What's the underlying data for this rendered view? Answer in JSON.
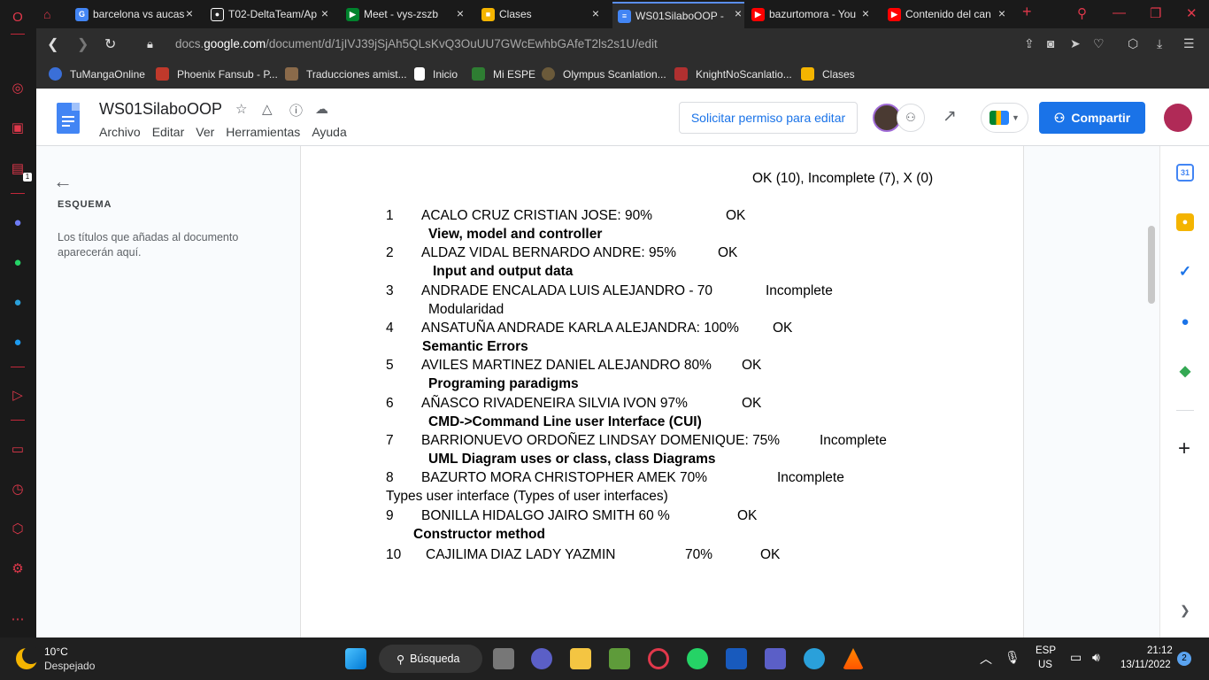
{
  "browser": {
    "tabs": [
      {
        "title": "barcelona vs aucas",
        "color": "#4285f4",
        "glyph": "G"
      },
      {
        "title": "T02-DeltaTeam/Ap",
        "color": "#222222",
        "glyph": "●"
      },
      {
        "title": "Meet - vys-zszb",
        "color": "#00832d",
        "glyph": "▶"
      },
      {
        "title": "Clases",
        "color": "#f4b400",
        "glyph": "■"
      },
      {
        "title": "WS01SilaboOOP -",
        "color": "#4285f4",
        "glyph": "≡"
      },
      {
        "title": "bazurtomora - You",
        "color": "#ff0000",
        "glyph": "▶"
      },
      {
        "title": "Contenido del can",
        "color": "#ff0000",
        "glyph": "▶"
      }
    ],
    "url_prefix": "docs.",
    "url_domain": "google.com",
    "url_path": "/document/d/1jIVJ39jSjAh5QLsKvQ3OuUU7GWcEwhbGAfeT2ls2s1U/edit",
    "bookmarks": [
      {
        "label": "TuMangaOnline",
        "color": "#3a6fd8"
      },
      {
        "label": "Phoenix Fansub - P...",
        "color": "#c0392b"
      },
      {
        "label": "Traducciones amist...",
        "color": "#8a6a4a"
      },
      {
        "label": "Inicio",
        "color": "#ffffff"
      },
      {
        "label": "Mi ESPE",
        "color": "#2e7d32"
      },
      {
        "label": "Olympus Scanlation...",
        "color": "#6b5a3a"
      },
      {
        "label": "KnightNoScanlatio...",
        "color": "#b03030"
      },
      {
        "label": "Clases",
        "color": "#f4b400"
      }
    ]
  },
  "docs": {
    "title": "WS01SilaboOOP",
    "menus": [
      "Archivo",
      "Editar",
      "Ver",
      "Herramientas",
      "Ayuda"
    ],
    "request_edit": "Solicitar permiso para editar",
    "share": "Compartir"
  },
  "outline": {
    "title": "ESQUEMA",
    "text": "Los títulos que añadas al documento aparecerán aquí."
  },
  "document": {
    "legend": "OK (10), Incomplete (7), X (0)",
    "entries": [
      {
        "num": "1",
        "name": "ACALO CRUZ CRISTIAN JOSE: 90%",
        "status": "OK",
        "topic": "View, model and controller",
        "topic_bold": true
      },
      {
        "num": "2",
        "name": "ALDAZ VIDAL BERNARDO ANDRE: 95%",
        "status": "OK",
        "topic": "Input and output data",
        "topic_bold": true
      },
      {
        "num": "3",
        "name": "ANDRADE ENCALADA LUIS ALEJANDRO - 70",
        "status": "Incomplete",
        "topic": "Modularidad",
        "topic_bold": false
      },
      {
        "num": "4",
        "name": "ANSATUÑA ANDRADE KARLA ALEJANDRA: 100%",
        "status": "OK",
        "topic": "Semantic Errors",
        "topic_bold": true
      },
      {
        "num": "5",
        "name": "AVILES MARTINEZ DANIEL ALEJANDRO 80%",
        "status": "OK",
        "topic": "Programing paradigms",
        "topic_bold": true
      },
      {
        "num": "6",
        "name": "AÑASCO RIVADENEIRA SILVIA IVON 97%",
        "status": "OK",
        "topic": "CMD->Command Line user Interface (CUI)",
        "topic_bold": true
      },
      {
        "num": "7",
        "name": "BARRIONUEVO ORDOÑEZ LINDSAY DOMENIQUE: 75%",
        "status": "Incomplete",
        "topic": "UML Diagram uses or class, class Diagrams",
        "topic_bold": true
      },
      {
        "num": "8",
        "name": "BAZURTO MORA CHRISTOPHER AMEK 70%",
        "status": "Incomplete",
        "topic": "Types user interface (Types of user interfaces)",
        "topic_bold": false
      },
      {
        "num": "9",
        "name": "BONILLA HIDALGO JAIRO SMITH  60 %",
        "status": "OK",
        "topic": "Constructor method",
        "topic_bold": true
      },
      {
        "num": "10",
        "name": "CAJILIMA DIAZ LADY YAZMIN",
        "pct": "70%",
        "status": "OK"
      }
    ]
  },
  "taskbar": {
    "temperature": "10°C",
    "weather": "Despejado",
    "search": "Búsqueda",
    "lang": "ESP",
    "region": "US",
    "time": "21:12",
    "date": "13/11/2022",
    "notifications": "2"
  }
}
